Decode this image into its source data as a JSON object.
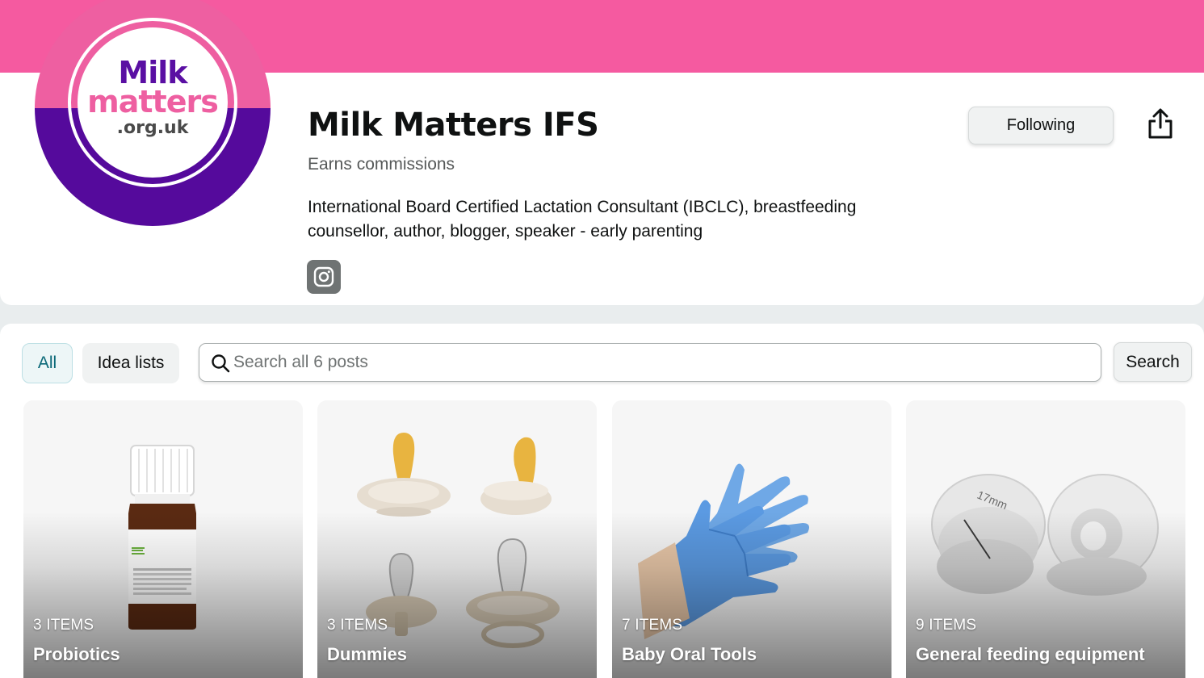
{
  "profile": {
    "logo_text": {
      "line1": "Milk",
      "line2": "matters",
      "line3": ".org.uk"
    },
    "name": "Milk Matters IFS",
    "commission_note": "Earns commissions",
    "bio": "International Board Certified Lactation Consultant (IBCLC), breastfeeding counsellor, author, blogger, speaker - early parenting",
    "social_icon": "instagram-icon",
    "follow_label": "Following",
    "share_icon": "share-icon"
  },
  "filters": {
    "all_label": "All",
    "idea_lists_label": "Idea lists"
  },
  "search": {
    "placeholder": "Search all 6 posts",
    "value": "",
    "button_label": "Search"
  },
  "lists": [
    {
      "count": "3 ITEMS",
      "title": "Probiotics"
    },
    {
      "count": "3 ITEMS",
      "title": "Dummies"
    },
    {
      "count": "7 ITEMS",
      "title": "Baby Oral Tools"
    },
    {
      "count": "9 ITEMS",
      "title": "General feeding equipment"
    }
  ],
  "colors": {
    "banner": "#f55aa0",
    "logo_pink": "#ee5fa1",
    "logo_purple": "#550a9c",
    "active_filter_text": "#0b6978"
  }
}
